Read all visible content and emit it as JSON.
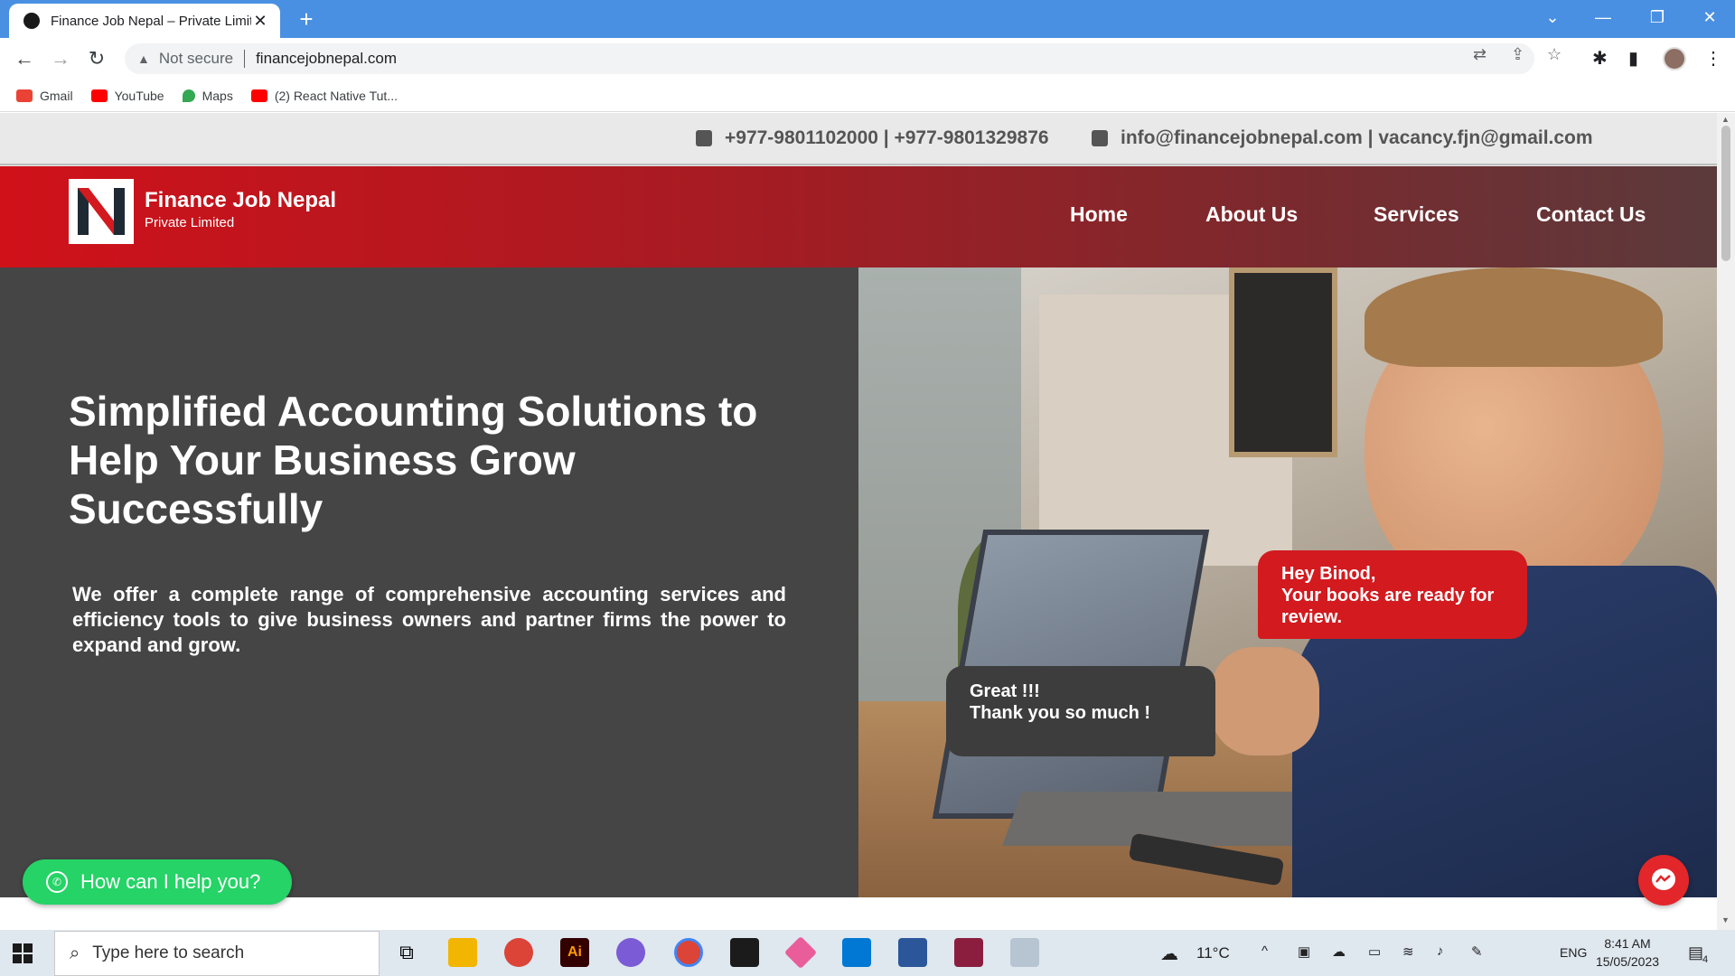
{
  "browser": {
    "tab_title": "Finance Job Nepal – Private Limit",
    "tab_close": "✕",
    "new_tab": "+",
    "security_label": "Not secure",
    "url": "financejobnepal.com",
    "bookmarks": [
      {
        "label": "Gmail",
        "color": "#ea4335"
      },
      {
        "label": "YouTube",
        "color": "#ff0000"
      },
      {
        "label": "Maps",
        "color": "#34a853"
      },
      {
        "label": "(2) React Native Tut...",
        "color": "#ff0000"
      }
    ],
    "titlebar_color": "#4a90e2"
  },
  "site": {
    "phone": "+977-9801102000 | +977-9801329876",
    "email": "info@financejobnepal.com | vacancy.fjn@gmail.com",
    "brand_name": "Finance Job Nepal",
    "brand_sub": "Private Limited",
    "nav": [
      "Home",
      "About Us",
      "Services",
      "Contact Us"
    ],
    "hero_title": "Simplified Accounting Solutions to Help Your Business Grow Successfully",
    "hero_subtitle": "We offer a complete range of comprehensive accounting services and efficiency tools to give business owners and partner firms the power to expand and grow.",
    "bubble_red_line1": "Hey Binod,",
    "bubble_red_line2": "Your books are ready for review.",
    "bubble_dark_line1": "Great !!!",
    "bubble_dark_line2": "Thank you so much !",
    "whatsapp_label": "How can I help you?",
    "accent_red": "#d21a1f",
    "hero_dark": "#454545"
  },
  "taskbar": {
    "search_placeholder": "Type here to search",
    "weather": "11°C",
    "language": "ENG",
    "time": "8:41 AM",
    "date": "15/05/2023",
    "notification_count": "4"
  }
}
